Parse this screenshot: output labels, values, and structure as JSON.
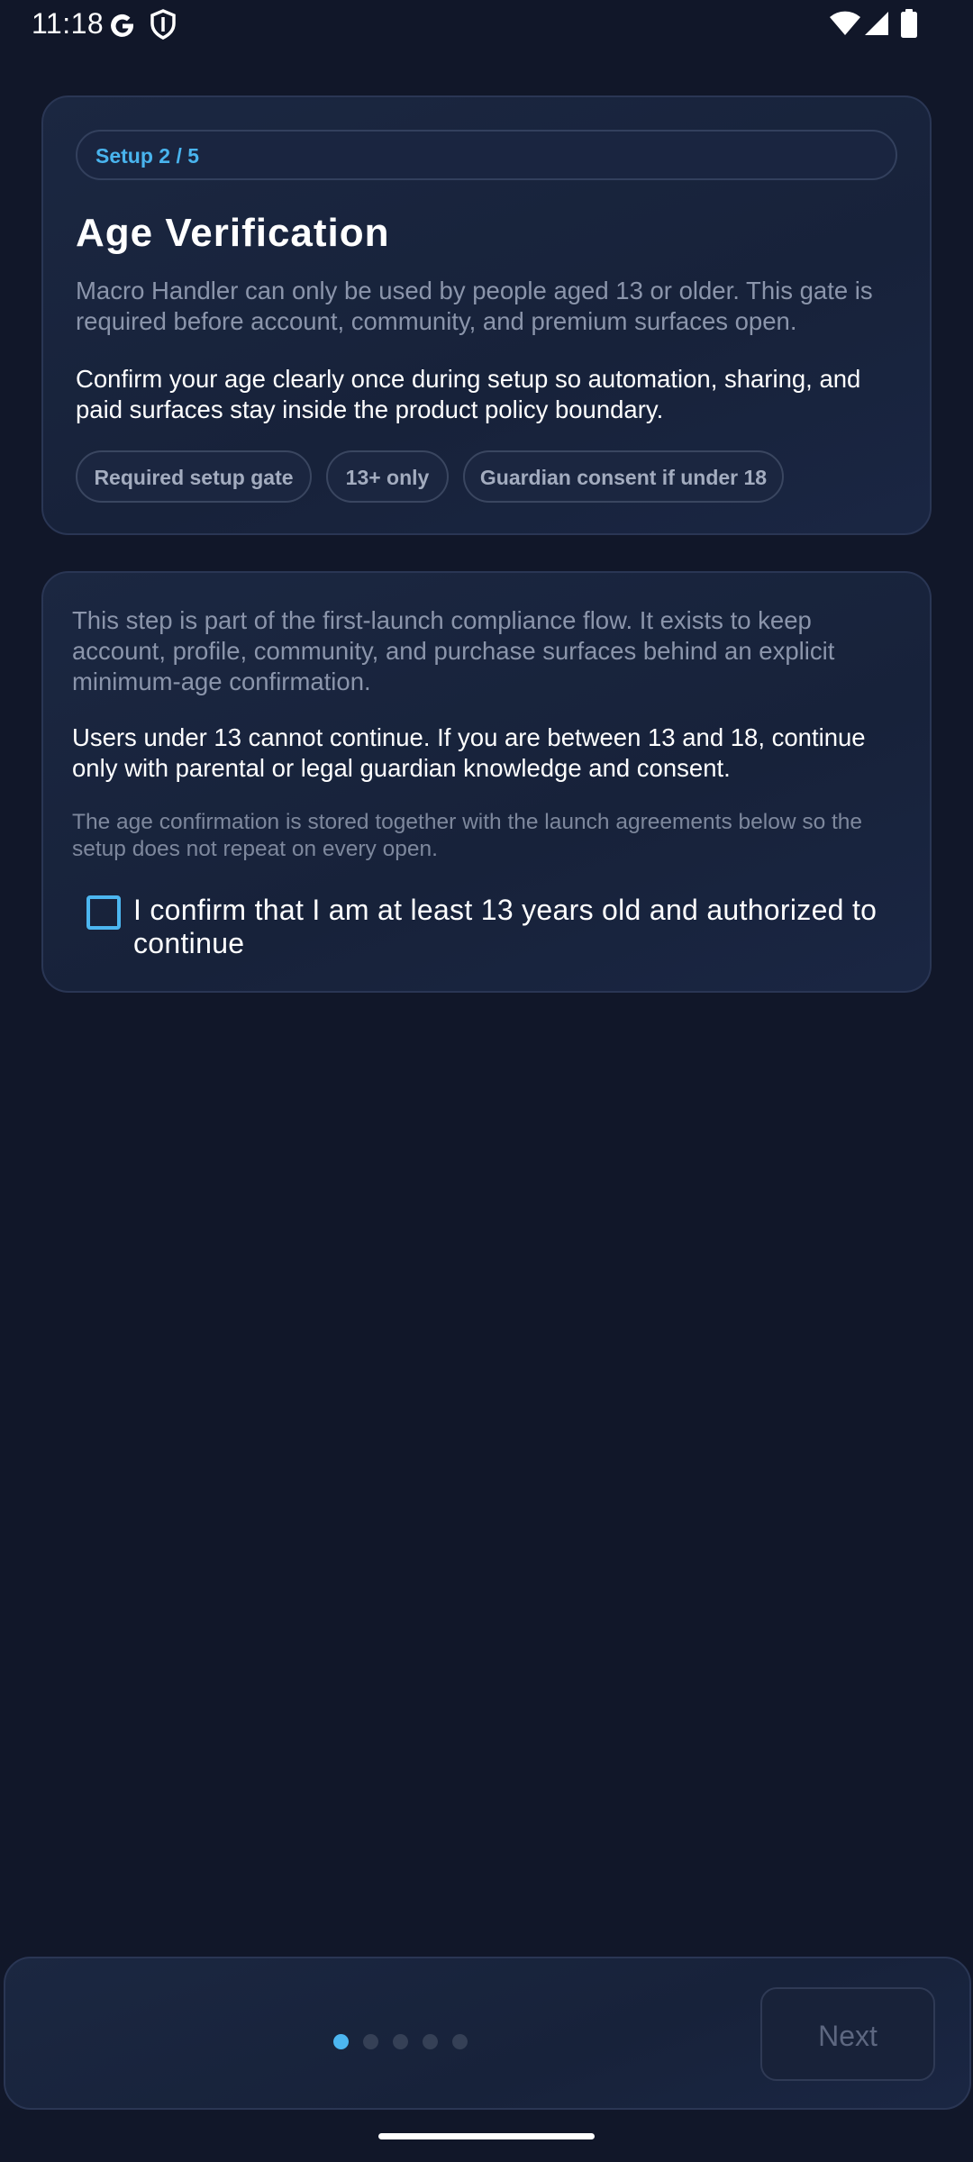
{
  "status_bar": {
    "time": "11:18",
    "icons": [
      "google-icon",
      "shield-icon",
      "wifi-icon",
      "cellular-signal-icon",
      "battery-icon"
    ]
  },
  "intro_card": {
    "step_label": "Setup 2 / 5",
    "title": "Age Verification",
    "description": "Macro Handler can only be used by people aged 13 or older. This gate is required before account, community, and premium surfaces open.",
    "emphasis": "Confirm your age clearly once during setup so automation, sharing, and paid surfaces stay inside the product policy boundary.",
    "chips": [
      "Required setup gate",
      "13+ only",
      "Guardian consent if under 18"
    ]
  },
  "detail_card": {
    "paragraph": "This step is part of the first-launch compliance flow. It exists to keep account, profile, community, and purchase surfaces behind an explicit minimum-age confirmation.",
    "warning": "Users under 13 cannot continue. If you are between 13 and 18, continue only with parental or legal guardian knowledge and consent.",
    "note": "The age confirmation is stored together with the launch agreements below so the setup does not repeat on every open.",
    "checkbox_label": "I confirm that I am at least 13 years old and authorized to continue",
    "checkbox_checked": false
  },
  "footer": {
    "page_count": 5,
    "current_page": 1,
    "next_label": "Next"
  },
  "colors": {
    "background": "#111729",
    "card": "#1b2741",
    "accent": "#4cb6f0",
    "muted_text": "#8b95ab"
  }
}
